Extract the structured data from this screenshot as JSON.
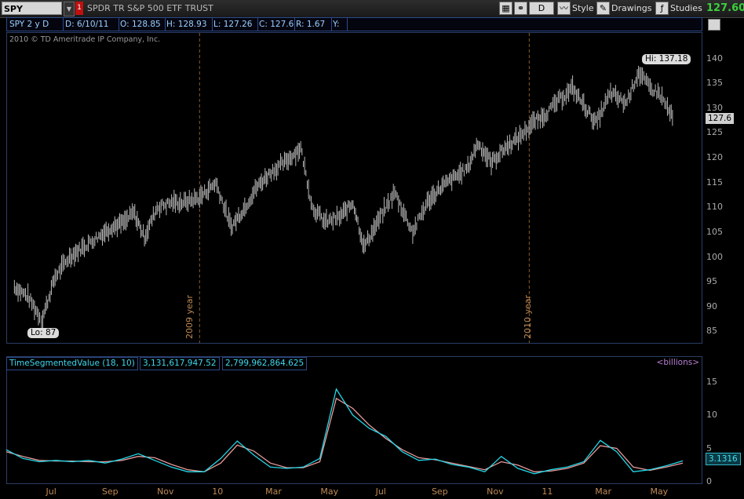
{
  "toolbar": {
    "symbol": "SPY",
    "link_indicator": "1",
    "description": "SPDR TR S&P 500 ETF TRUST",
    "aggregation": "D",
    "style_label": "Style",
    "drawings_label": "Drawings",
    "studies_label": "Studies",
    "last_price": "127.60",
    "icons": [
      "chart-settings-icon",
      "link-icon",
      "period-icon",
      "style-icon",
      "drawings-icon",
      "studies-icon"
    ]
  },
  "infobar": {
    "chart_id": "SPY 2 y D",
    "date": "D: 6/10/11",
    "open": "O: 128.85",
    "high": "H: 128.93",
    "low": "L: 127.26",
    "close": "C: 127.6",
    "range": "R: 1.67",
    "y": "Y:"
  },
  "copyright": "2010 © TD Ameritrade IP Company, Inc.",
  "annotations": {
    "high_bubble": "Hi: 137.18",
    "low_bubble": "Lo: 87",
    "price_tag": "127.6",
    "year_2009": "2009 year",
    "year_2010": "2010 year"
  },
  "study": {
    "name": "TimeSegmentedValue (18, 10)",
    "value1": "3,131,617,947.52",
    "value2": "2,799,962,864.625",
    "units": "<billions>",
    "tag": "3.1316"
  },
  "colors": {
    "price_bars": "#b8b8b8",
    "tsv_fast": "#22d8e8",
    "tsv_slow": "#e89a9a",
    "year_marker": "#8a5a2a",
    "last_price": "#3ccf3c"
  },
  "chart_data": [
    {
      "type": "line",
      "description_series": "SPY daily price (2 years)",
      "x": [
        "Jul",
        "Sep",
        "Nov",
        "10",
        "Mar",
        "May",
        "Jul",
        "Sep",
        "Nov",
        "11",
        "Mar",
        "May"
      ],
      "y_ticks": [
        85,
        90,
        95,
        100,
        105,
        110,
        115,
        120,
        125,
        130,
        135,
        140
      ],
      "ylim": [
        83,
        142
      ],
      "points": [
        {
          "x": "2009-06-10",
          "y": 94
        },
        {
          "x": "2009-06-25",
          "y": 92
        },
        {
          "x": "2009-07-08",
          "y": 88
        },
        {
          "x": "2009-07-10",
          "y": 87
        },
        {
          "x": "2009-07-25",
          "y": 96
        },
        {
          "x": "2009-08-10",
          "y": 100
        },
        {
          "x": "2009-08-25",
          "y": 102
        },
        {
          "x": "2009-09-10",
          "y": 104
        },
        {
          "x": "2009-09-25",
          "y": 106
        },
        {
          "x": "2009-10-10",
          "y": 107
        },
        {
          "x": "2009-10-20",
          "y": 109
        },
        {
          "x": "2009-11-01",
          "y": 104
        },
        {
          "x": "2009-11-15",
          "y": 110
        },
        {
          "x": "2009-12-01",
          "y": 111
        },
        {
          "x": "2009-12-15",
          "y": 111
        },
        {
          "x": "2010-01-01",
          "y": 112
        },
        {
          "x": "2010-01-19",
          "y": 115
        },
        {
          "x": "2010-02-05",
          "y": 106
        },
        {
          "x": "2010-02-20",
          "y": 110
        },
        {
          "x": "2010-03-05",
          "y": 114
        },
        {
          "x": "2010-03-20",
          "y": 117
        },
        {
          "x": "2010-04-05",
          "y": 119
        },
        {
          "x": "2010-04-23",
          "y": 122
        },
        {
          "x": "2010-05-06",
          "y": 110
        },
        {
          "x": "2010-05-20",
          "y": 107
        },
        {
          "x": "2010-06-05",
          "y": 108
        },
        {
          "x": "2010-06-20",
          "y": 111
        },
        {
          "x": "2010-07-02",
          "y": 102
        },
        {
          "x": "2010-07-20",
          "y": 108
        },
        {
          "x": "2010-08-05",
          "y": 113
        },
        {
          "x": "2010-08-25",
          "y": 105
        },
        {
          "x": "2010-09-10",
          "y": 111
        },
        {
          "x": "2010-09-25",
          "y": 114
        },
        {
          "x": "2010-10-10",
          "y": 116
        },
        {
          "x": "2010-10-25",
          "y": 118
        },
        {
          "x": "2010-11-05",
          "y": 123
        },
        {
          "x": "2010-11-20",
          "y": 119
        },
        {
          "x": "2010-12-05",
          "y": 122
        },
        {
          "x": "2010-12-20",
          "y": 124
        },
        {
          "x": "2011-01-05",
          "y": 127
        },
        {
          "x": "2011-01-20",
          "y": 129
        },
        {
          "x": "2011-02-05",
          "y": 132
        },
        {
          "x": "2011-02-18",
          "y": 134
        },
        {
          "x": "2011-03-01",
          "y": 131
        },
        {
          "x": "2011-03-16",
          "y": 127
        },
        {
          "x": "2011-04-01",
          "y": 133
        },
        {
          "x": "2011-04-18",
          "y": 131
        },
        {
          "x": "2011-05-02",
          "y": 137.18
        },
        {
          "x": "2011-05-15",
          "y": 134
        },
        {
          "x": "2011-05-25",
          "y": 133
        },
        {
          "x": "2011-06-03",
          "y": 130
        },
        {
          "x": "2011-06-10",
          "y": 127.6
        }
      ]
    },
    {
      "type": "line",
      "title": "TimeSegmentedValue (18, 10)",
      "units": "<billions>",
      "y_ticks": [
        0,
        5,
        10,
        15
      ],
      "ylim": [
        0,
        16
      ],
      "series": [
        {
          "values_fast": [
            4.8,
            3.5,
            3.0,
            3.2,
            3.0,
            3.2,
            2.8,
            3.4,
            4.2,
            3.2,
            2.2,
            1.5,
            1.5,
            3.5,
            6.1,
            4.0,
            2.2,
            2.0,
            2.2,
            3.5,
            13.9,
            10.0,
            8.0,
            6.8,
            4.5,
            3.2,
            3.4,
            2.6,
            2.2,
            1.5,
            3.8,
            2.0,
            1.2,
            1.8,
            2.2,
            3.0,
            6.2,
            4.5,
            1.5,
            1.8,
            2.4,
            3.1316
          ],
          "values_slow": [
            4.5,
            3.8,
            3.2,
            3.1,
            3.1,
            3.0,
            3.0,
            3.2,
            3.8,
            3.6,
            2.6,
            1.8,
            1.5,
            2.8,
            5.5,
            4.6,
            2.8,
            2.1,
            2.1,
            3.0,
            12.5,
            11.0,
            8.5,
            6.5,
            4.8,
            3.6,
            3.3,
            2.8,
            2.3,
            1.8,
            3.0,
            2.5,
            1.5,
            1.6,
            2.0,
            2.8,
            5.4,
            5.0,
            2.2,
            1.7,
            2.2,
            2.8
          ]
        }
      ]
    }
  ]
}
